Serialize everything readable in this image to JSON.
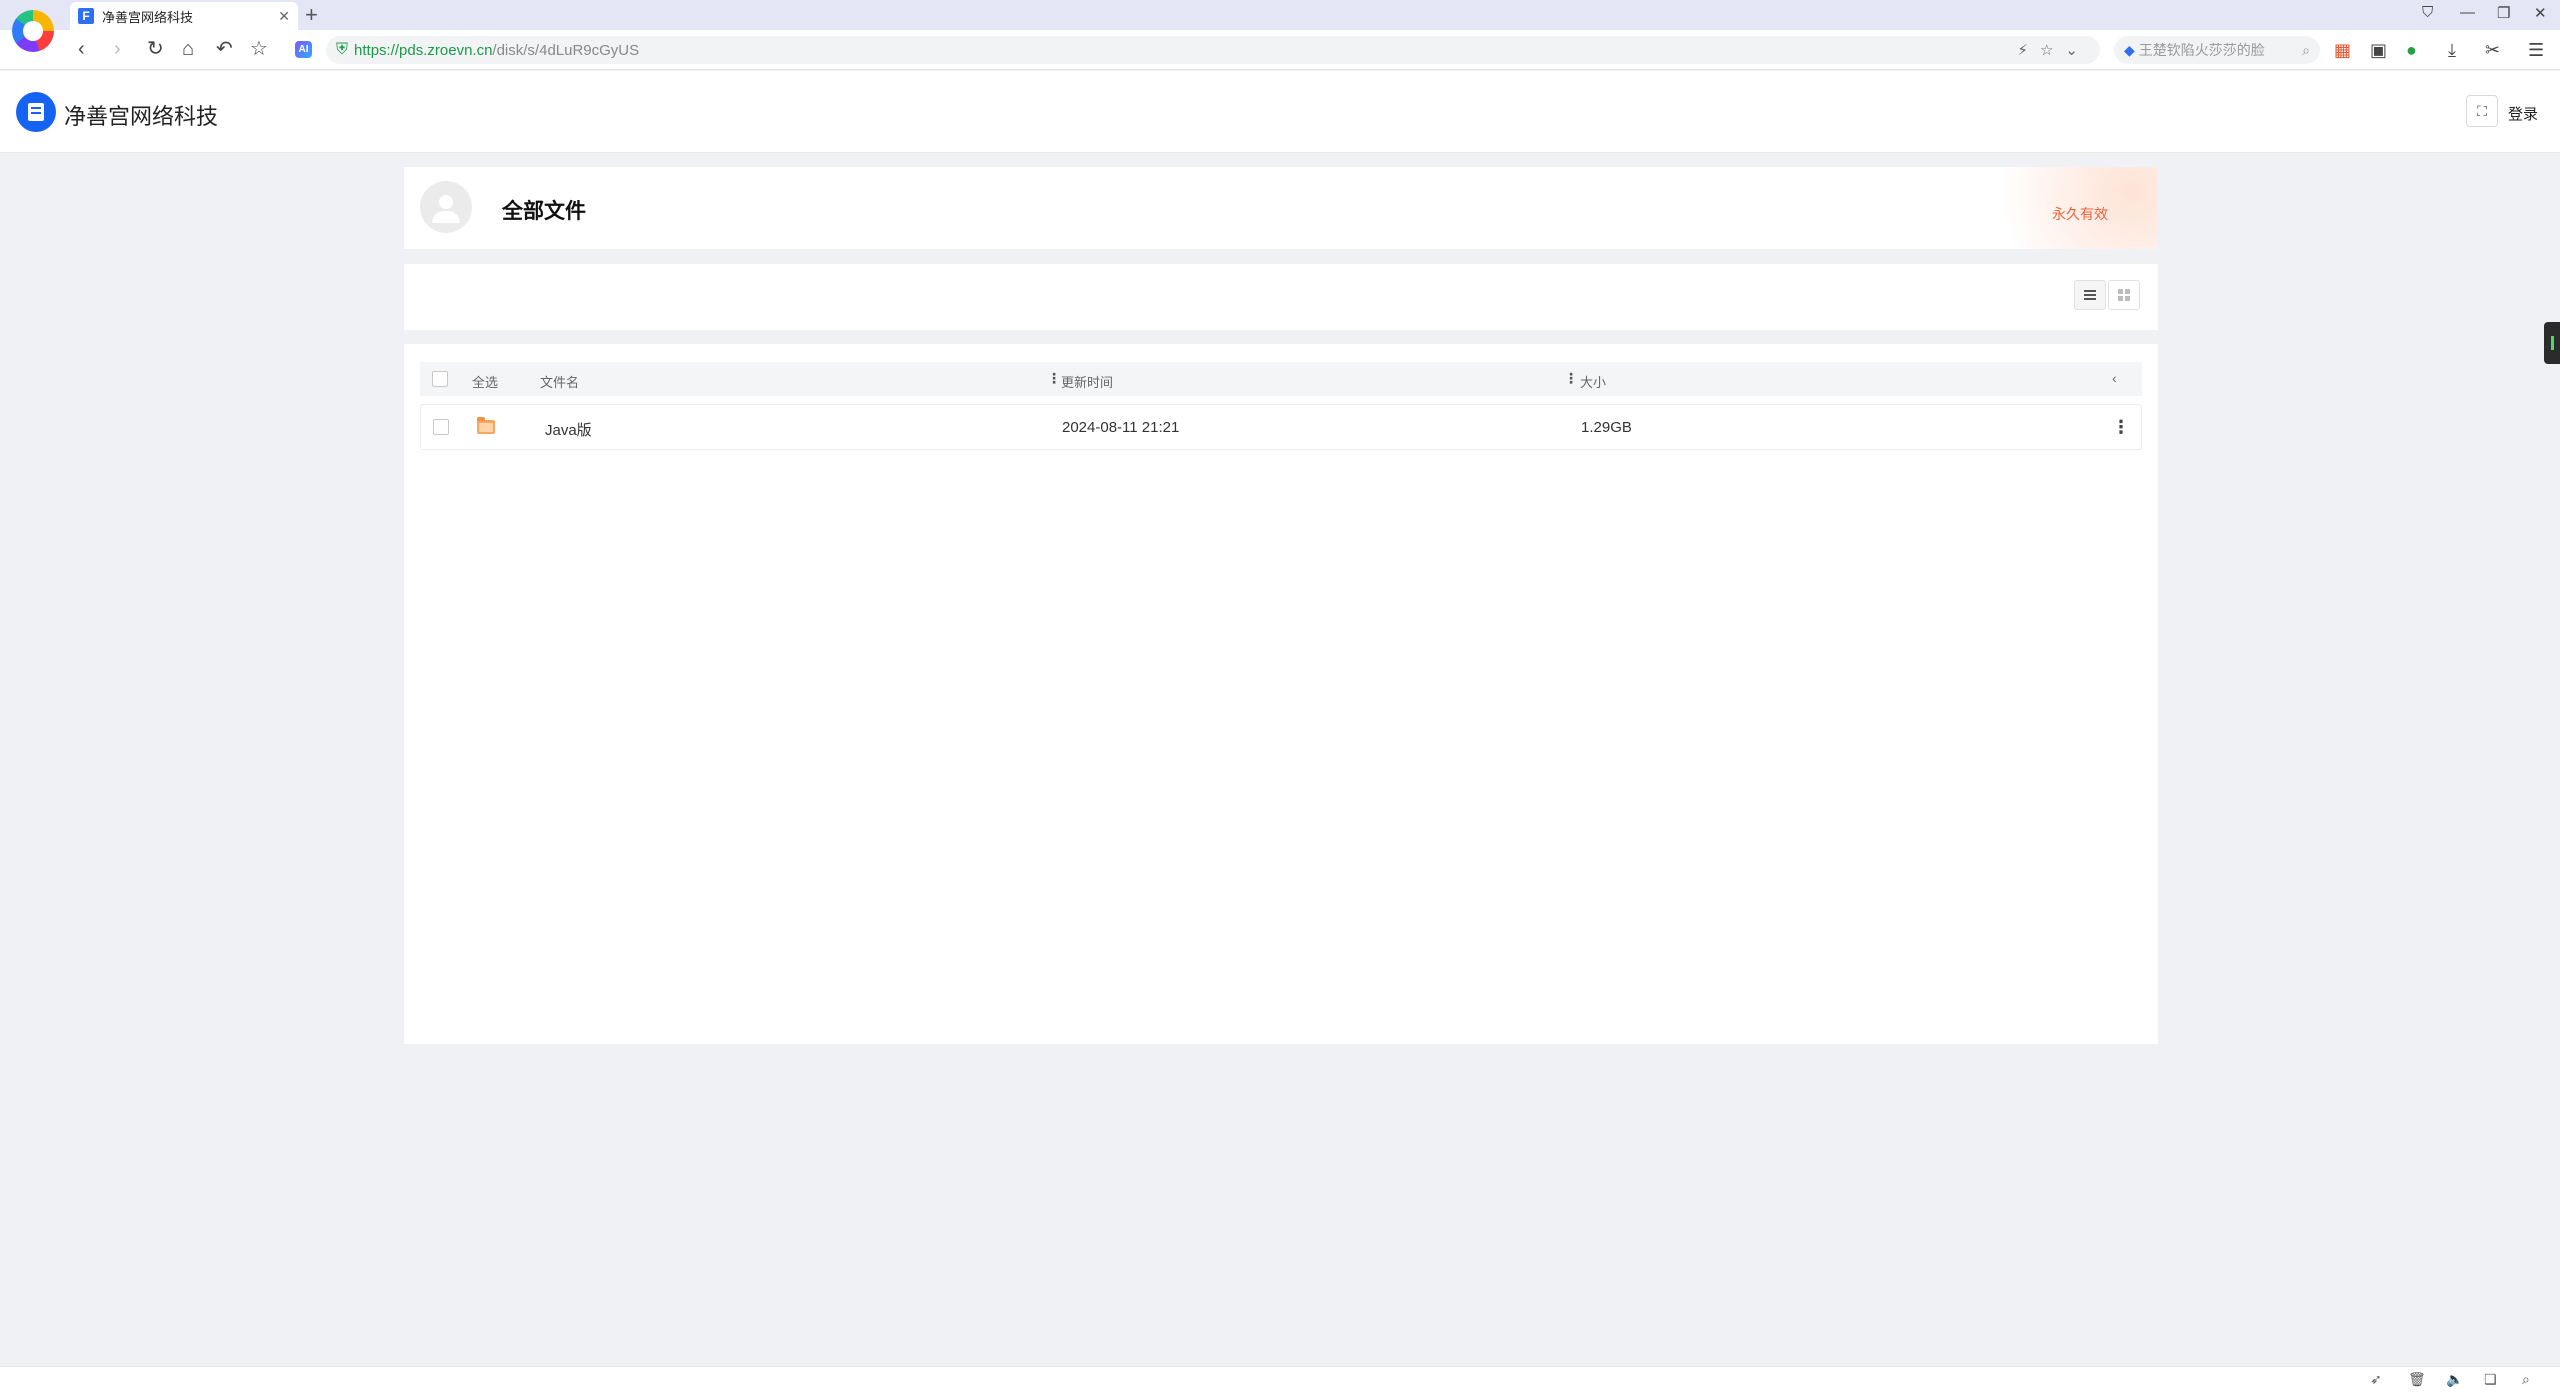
{
  "browser": {
    "tab_title": "净善宫网络科技",
    "tab_favicon_letter": "F",
    "new_tab": "+",
    "url_host": "https://pds.zroevn.cn",
    "url_path": "/disk/s/4dLuR9cGyUS",
    "ai_badge": "AI",
    "search_placeholder": "王楚钦陷火莎莎的脸",
    "icons": [
      "back-icon",
      "forward-icon",
      "refresh-icon",
      "home-icon",
      "undo-icon",
      "star-icon",
      "shield-icon",
      "lightning-icon",
      "favorite-icon",
      "chevron-down-icon",
      "search-icon",
      "apps-icon",
      "window-icon",
      "game-icon",
      "download-icon",
      "scissors-icon",
      "menu-icon"
    ]
  },
  "site": {
    "brand_name": "净善宫网络科技",
    "login_label": "登录",
    "qr_icon": "qr-scan-icon"
  },
  "share": {
    "title": "全部文件",
    "validity": "永久有效"
  },
  "table": {
    "headers": {
      "select_all": "全选",
      "name": "文件名",
      "updated": "更新时间",
      "size": "大小"
    },
    "rows": [
      {
        "name": "Java版",
        "updated": "2024-08-11 21:21",
        "size": "1.29GB",
        "type": "folder"
      }
    ]
  },
  "colors": {
    "accent": "#1463f3",
    "validity": "#f0623a",
    "url_host": "#1a9a46",
    "folder": "#f8a562"
  }
}
